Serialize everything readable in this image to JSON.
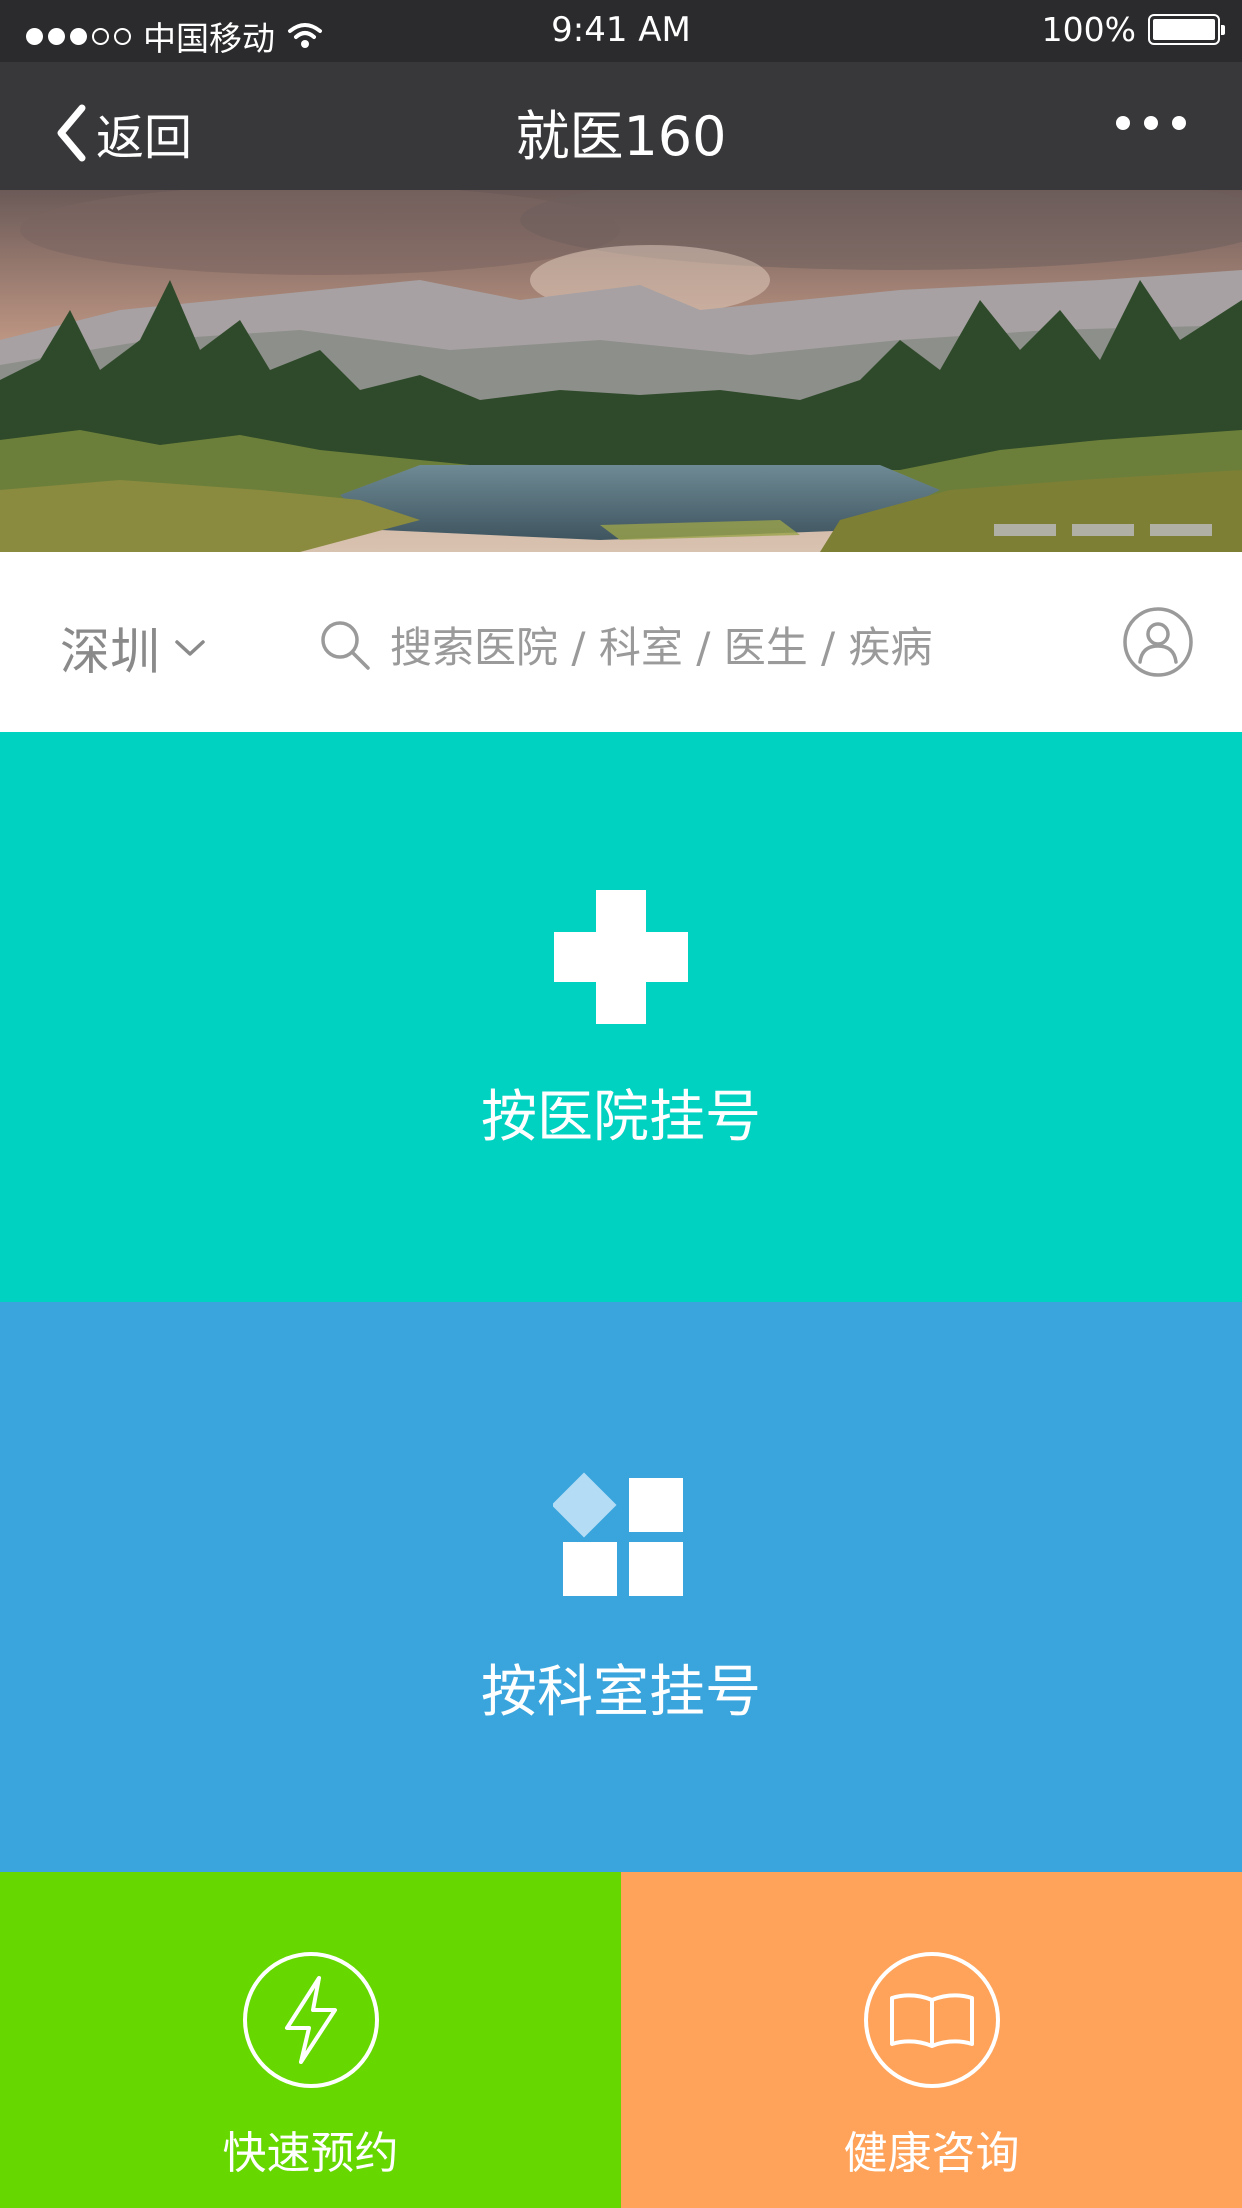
{
  "status_bar": {
    "carrier": "中国移动",
    "time": "9:41 AM",
    "battery": "100%"
  },
  "nav": {
    "back_label": "返回",
    "title": "就医160"
  },
  "banner": {
    "slide_count": 3
  },
  "search_row": {
    "city": "深圳",
    "search_placeholder": "搜索医院 / 科室 / 医生 / 疾病"
  },
  "tiles": {
    "hospital": {
      "label": "按医院挂号",
      "color": "#00d2c2"
    },
    "department": {
      "label": "按科室挂号",
      "color": "#3aa5dd"
    },
    "quick": {
      "label": "快速预约",
      "color": "#66d800"
    },
    "health": {
      "label": "健康咨询",
      "color": "#ffa35a"
    }
  },
  "icons": {
    "hospital": "cross-icon",
    "department": "grid-icon",
    "quick": "lightning-icon",
    "health": "book-icon"
  }
}
